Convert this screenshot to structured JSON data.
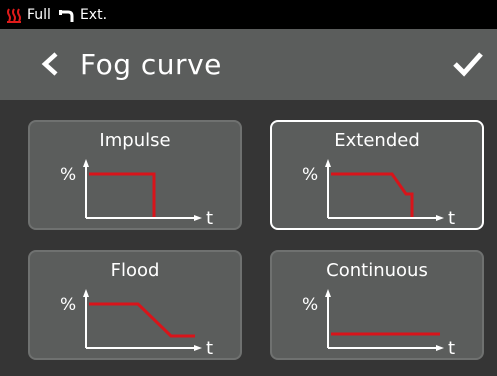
{
  "status": {
    "mode_label": "Full",
    "ext_label": "Ext."
  },
  "header": {
    "title": "Fog curve"
  },
  "curves": [
    {
      "label": "Impulse",
      "axis_y": "%",
      "axis_x": "t",
      "selected": false
    },
    {
      "label": "Extended",
      "axis_y": "%",
      "axis_x": "t",
      "selected": true
    },
    {
      "label": "Flood",
      "axis_y": "%",
      "axis_x": "t",
      "selected": false
    },
    {
      "label": "Continuous",
      "axis_y": "%",
      "axis_x": "t",
      "selected": false
    }
  ],
  "colors": {
    "curve": "#d8141a",
    "background": "#353535",
    "panel": "#5b5d5c"
  }
}
